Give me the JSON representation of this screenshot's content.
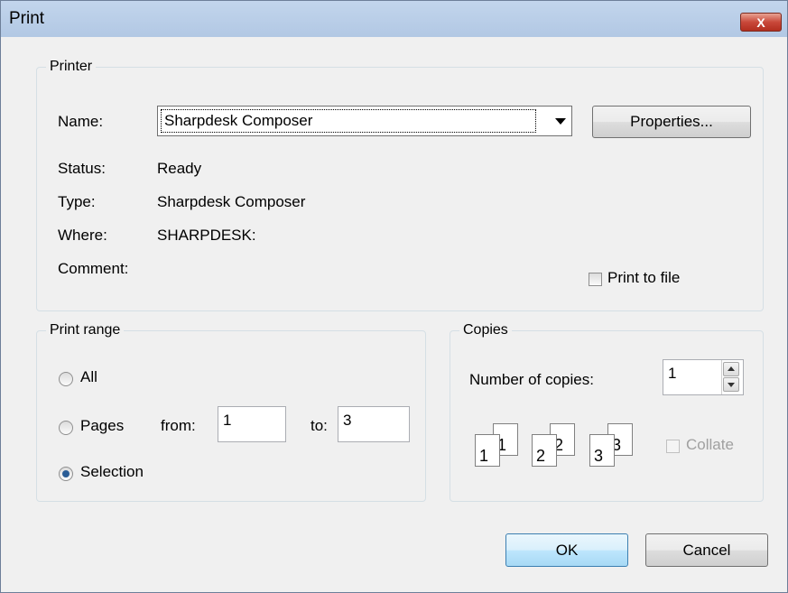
{
  "window": {
    "title": "Print",
    "close_label": "X"
  },
  "printer": {
    "group_label": "Printer",
    "name_label": "Name:",
    "name_value": "Sharpdesk Composer",
    "properties_button": "Properties...",
    "status_label": "Status:",
    "status_value": "Ready",
    "type_label": "Type:",
    "type_value": "Sharpdesk Composer",
    "where_label": "Where:",
    "where_value": "SHARPDESK:",
    "comment_label": "Comment:",
    "comment_value": "",
    "print_to_file_label": "Print to file",
    "print_to_file_checked": false
  },
  "print_range": {
    "group_label": "Print range",
    "all_label": "All",
    "pages_label": "Pages",
    "from_label": "from:",
    "from_value": "1",
    "to_label": "to:",
    "to_value": "3",
    "selection_label": "Selection",
    "selected": "Selection"
  },
  "copies": {
    "group_label": "Copies",
    "number_label": "Number of copies:",
    "number_value": "1",
    "collate_label": "Collate",
    "collate_checked": false,
    "collate_enabled": false,
    "page_icons": [
      "1",
      "1",
      "2",
      "2",
      "3",
      "3"
    ]
  },
  "footer": {
    "ok_label": "OK",
    "cancel_label": "Cancel"
  },
  "colors": {
    "title_bar": "#b9cfe9",
    "close_button": "#c9483a",
    "default_button_border": "#3c7fb1",
    "radio_dot": "#2a5d96"
  }
}
